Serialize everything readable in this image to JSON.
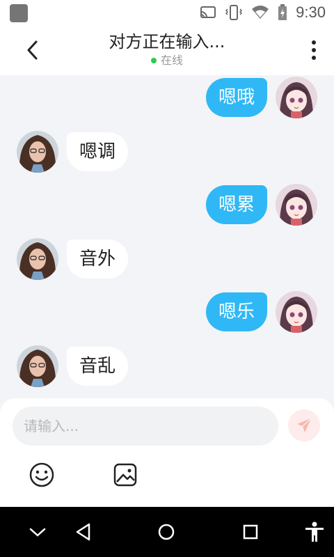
{
  "status_bar": {
    "time": "9:30",
    "icons": [
      "app-icon",
      "cast-icon",
      "vibrate-icon",
      "wifi-icon",
      "battery-icon"
    ]
  },
  "header": {
    "title": "对方正在输入...",
    "presence": "在线",
    "presence_color": "#2ecb4a",
    "back_icon": "chevron-left-icon",
    "menu_icon": "more-vertical-icon"
  },
  "messages": [
    {
      "side": "right",
      "text": "嗯哦"
    },
    {
      "side": "left",
      "text": "嗯调"
    },
    {
      "side": "right",
      "text": "嗯累"
    },
    {
      "side": "left",
      "text": "音外"
    },
    {
      "side": "right",
      "text": "嗯乐"
    },
    {
      "side": "left",
      "text": "音乱"
    }
  ],
  "composer": {
    "placeholder": "请输入...",
    "value": "",
    "send_icon": "send-icon",
    "tools": [
      "emoji-icon",
      "image-icon"
    ]
  },
  "colors": {
    "accent": "#2fb8f5",
    "background": "#f3f4f7",
    "send_button": "#fdeceb"
  },
  "nav_bar": {
    "icons": [
      "collapse-icon",
      "back-icon",
      "home-icon",
      "recents-icon",
      "accessibility-icon"
    ]
  }
}
